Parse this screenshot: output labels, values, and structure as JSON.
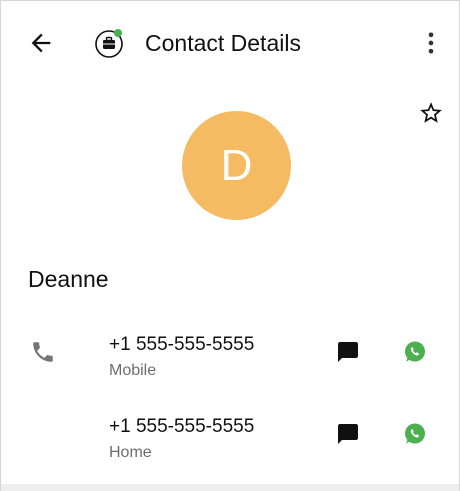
{
  "header": {
    "title": "Contact Details",
    "icons": {
      "back": "arrow-back-icon",
      "profile": "work-profile-icon",
      "menu": "more-vertical-icon"
    }
  },
  "contact": {
    "avatar_letter": "D",
    "avatar_color": "#f4bb63",
    "name": "Deanne",
    "favorite_icon": "star-outline-icon",
    "phones": [
      {
        "number": "+1 555-555-5555",
        "type": "Mobile"
      },
      {
        "number": "+1 555-555-5555",
        "type": "Home"
      }
    ]
  },
  "colors": {
    "whatsapp": "#4caf50",
    "status_dot": "#4caf50",
    "secondary_text": "#6d6d6d"
  }
}
